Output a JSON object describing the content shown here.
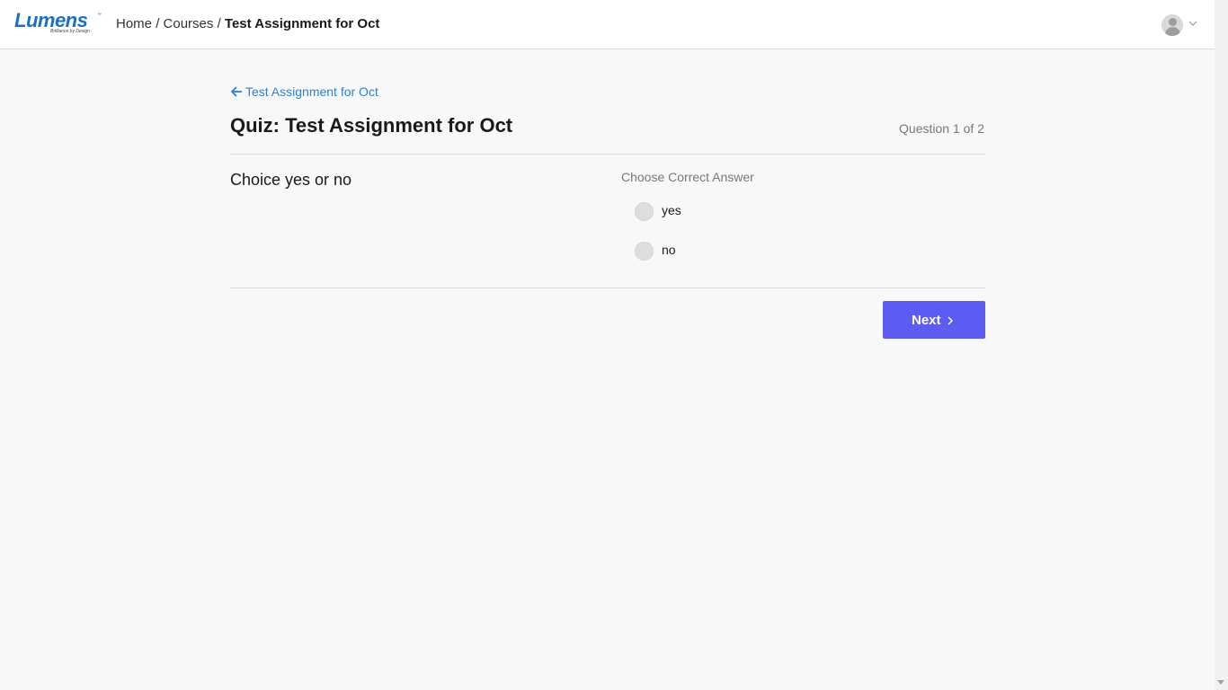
{
  "header": {
    "logo": {
      "name": "Lumens",
      "tagline": "Brilliance by Design",
      "trademark": "™"
    },
    "breadcrumb": {
      "items": [
        "Home",
        "Courses"
      ],
      "separator": "/",
      "current": "Test Assignment for Oct"
    },
    "user_menu": {
      "avatar_icon": "user-avatar-icon",
      "caret_icon": "chevron-down-icon"
    }
  },
  "quiz": {
    "back_link": "Test Assignment for Oct",
    "title": "Quiz: Test Assignment for Oct",
    "counter": "Question 1 of 2",
    "question": "Choice yes or no",
    "answer_heading": "Choose Correct Answer",
    "options": [
      {
        "label": "yes",
        "selected": false
      },
      {
        "label": "no",
        "selected": false
      }
    ],
    "next_label": "Next"
  },
  "colors": {
    "accent": "#5c5cf3",
    "link": "#2f80d1",
    "brand": "#1d6fc0",
    "background": "#f8f8f8"
  }
}
